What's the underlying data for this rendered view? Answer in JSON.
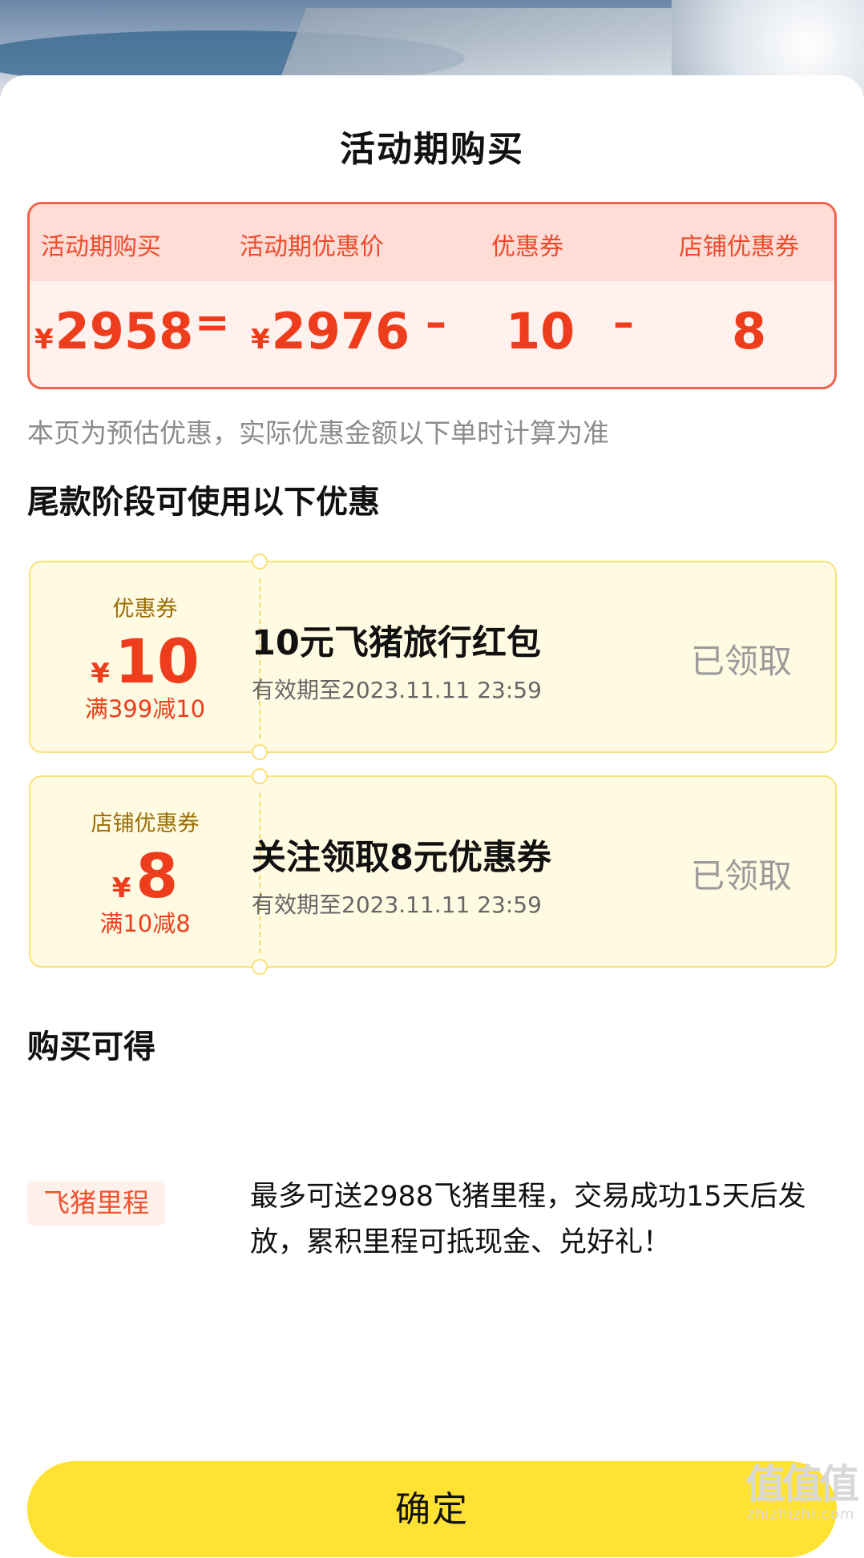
{
  "page": {
    "title": "活动期购买",
    "confirm_label": "确定"
  },
  "calculation": {
    "labels": [
      "活动期购买",
      "活动期优惠价",
      "优惠券",
      "店铺优惠券"
    ],
    "currency": "¥",
    "purchase_price": "2958",
    "promo_price": "2976",
    "coupon_value": "10",
    "shop_coupon_value": "8",
    "equals": "=",
    "minus": "–"
  },
  "note": "本页为预估优惠，实际优惠金额以下单时计算为准",
  "coupons_section": {
    "title": "尾款阶段可使用以下优惠",
    "items": [
      {
        "type": "优惠券",
        "currency": "¥",
        "amount": "10",
        "condition": "满399减10",
        "name": "10元飞猪旅行红包",
        "validity": "有效期至2023.11.11 23:59",
        "status": "已领取"
      },
      {
        "type": "店铺优惠券",
        "currency": "¥",
        "amount": "8",
        "condition": "满10减8",
        "name": "关注领取8元优惠券",
        "validity": "有效期至2023.11.11 23:59",
        "status": "已领取"
      }
    ]
  },
  "benefits_section": {
    "title": "购买可得",
    "badge": "飞猪里程",
    "line1": "最多可送2988飞猪里程，交易成功15天后发",
    "line2": "放，累积里程可抵现金、兑好礼！"
  },
  "watermark": {
    "logo": "值值值",
    "url": "zhizhizhi.com"
  },
  "colors": {
    "accent_red": "#ee3d1c",
    "coupon_bg": "#fffbe3",
    "confirm_yellow": "#ffe234"
  }
}
